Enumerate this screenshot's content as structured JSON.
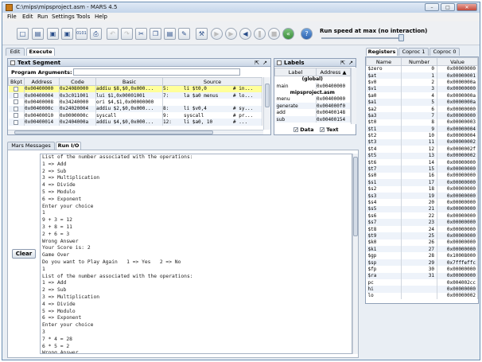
{
  "window": {
    "title": "C:\\mips\\mipsproject.asm  - MARS 4.5"
  },
  "menu": [
    "File",
    "Edit",
    "Run",
    "Settings",
    "Tools",
    "Help"
  ],
  "toolbar": {
    "speed_label": "Run speed at max (no interaction)"
  },
  "tabs": {
    "edit": "Edit",
    "execute": "Execute"
  },
  "text_segment": {
    "title": "Text Segment",
    "program_arguments": "Program Arguments:",
    "columns": [
      "Bkpt",
      "Address",
      "Code",
      "Basic",
      "Source"
    ],
    "rows": [
      {
        "address": "0x00400000",
        "code": "0x24080000",
        "basic": "addiu $8,$0,0x000...",
        "line": "5:",
        "source": "li $t0,0",
        "comment": "# in..."
      },
      {
        "address": "0x00400004",
        "code": "0x3c011001",
        "basic": "lui $1,0x00001001",
        "line": "7:",
        "source": "la $a0 menus",
        "comment": "# lo..."
      },
      {
        "address": "0x00400008",
        "code": "0x34240000",
        "basic": "ori $4,$1,0x00000000",
        "line": "",
        "source": "",
        "comment": ""
      },
      {
        "address": "0x0040000c",
        "code": "0x24020004",
        "basic": "addiu $2,$0,0x000...",
        "line": "8:",
        "source": "li $v0,4",
        "comment": "# sy..."
      },
      {
        "address": "0x00400010",
        "code": "0x0000000c",
        "basic": "syscall",
        "line": "9:",
        "source": "syscall",
        "comment": "# pr..."
      },
      {
        "address": "0x00400014",
        "code": "0x2404000a",
        "basic": "addiu $4,$0,0x000...",
        "line": "12:",
        "source": "li $a0, 10",
        "comment": "# ..."
      }
    ]
  },
  "labels": {
    "title": "Labels",
    "columns": [
      "Label",
      "Address ▲"
    ],
    "groups": [
      {
        "name": "(global)",
        "items": [
          {
            "label": "main",
            "address": "0x00400000"
          }
        ]
      },
      {
        "name": "mipsproject.asm",
        "items": [
          {
            "label": "menu",
            "address": "0x00400000"
          },
          {
            "label": "generate",
            "address": "0x004000f0"
          },
          {
            "label": "add",
            "address": "0x00400148"
          },
          {
            "label": "sub",
            "address": "0x00400154"
          }
        ]
      }
    ],
    "data_check": "Data",
    "text_check": "Text"
  },
  "bottom_tabs": {
    "messages": "Mars Messages",
    "run_io": "Run I/O"
  },
  "clear_button": "Clear",
  "console_lines": [
    "List of the number associated with the operations:",
    "1 => Add",
    "2 => Sub",
    "3 => Multiplication",
    "4 => Divide",
    "5 => Modulo",
    "6 => Exponent",
    "Enter your choice",
    "1",
    "9 + 3 = 12",
    "3 + 8 = 11",
    "2 + 6 = 3",
    "Wrong Answer",
    "Your Score is: 2",
    "Game Over",
    "Do you want to Play Again   1 => Yes   2 => No",
    "1",
    "List of the number associated with the operations:",
    "1 => Add",
    "2 => Sub",
    "3 => Multiplication",
    "4 => Divide",
    "5 => Modulo",
    "6 => Exponent",
    "Enter your choice",
    "3",
    "7 * 4 = 28",
    "6 * 5 = 2",
    "Wrong Answer"
  ],
  "register_tabs": [
    "Registers",
    "Coproc 1",
    "Coproc 0"
  ],
  "register_columns": [
    "Name",
    "Number",
    "Value"
  ],
  "registers": [
    {
      "name": "$zero",
      "number": "0",
      "value": "0x00000000"
    },
    {
      "name": "$at",
      "number": "1",
      "value": "0x00000001"
    },
    {
      "name": "$v0",
      "number": "2",
      "value": "0x0000000a"
    },
    {
      "name": "$v1",
      "number": "3",
      "value": "0x00000000"
    },
    {
      "name": "$a0",
      "number": "4",
      "value": "0x0000000a"
    },
    {
      "name": "$a1",
      "number": "5",
      "value": "0x0000000a"
    },
    {
      "name": "$a2",
      "number": "6",
      "value": "0x00000000"
    },
    {
      "name": "$a3",
      "number": "7",
      "value": "0x00000000"
    },
    {
      "name": "$t0",
      "number": "8",
      "value": "0x00000003"
    },
    {
      "name": "$t1",
      "number": "9",
      "value": "0x00000004"
    },
    {
      "name": "$t2",
      "number": "10",
      "value": "0x00000004"
    },
    {
      "name": "$t3",
      "number": "11",
      "value": "0x00000002"
    },
    {
      "name": "$t4",
      "number": "12",
      "value": "0x0000002f"
    },
    {
      "name": "$t5",
      "number": "13",
      "value": "0x00000002"
    },
    {
      "name": "$t6",
      "number": "14",
      "value": "0x00000000"
    },
    {
      "name": "$t7",
      "number": "15",
      "value": "0x00000000"
    },
    {
      "name": "$s0",
      "number": "16",
      "value": "0x00000000"
    },
    {
      "name": "$s1",
      "number": "17",
      "value": "0x00000000"
    },
    {
      "name": "$s2",
      "number": "18",
      "value": "0x00000000"
    },
    {
      "name": "$s3",
      "number": "19",
      "value": "0x00000000"
    },
    {
      "name": "$s4",
      "number": "20",
      "value": "0x00000000"
    },
    {
      "name": "$s5",
      "number": "21",
      "value": "0x00000000"
    },
    {
      "name": "$s6",
      "number": "22",
      "value": "0x00000000"
    },
    {
      "name": "$s7",
      "number": "23",
      "value": "0x00000000"
    },
    {
      "name": "$t8",
      "number": "24",
      "value": "0x00000000"
    },
    {
      "name": "$t9",
      "number": "25",
      "value": "0x00000000"
    },
    {
      "name": "$k0",
      "number": "26",
      "value": "0x00000000"
    },
    {
      "name": "$k1",
      "number": "27",
      "value": "0x00000000"
    },
    {
      "name": "$gp",
      "number": "28",
      "value": "0x10008000"
    },
    {
      "name": "$sp",
      "number": "29",
      "value": "0x7fffeffc"
    },
    {
      "name": "$fp",
      "number": "30",
      "value": "0x00000000"
    },
    {
      "name": "$ra",
      "number": "31",
      "value": "0x00000000"
    },
    {
      "name": "pc",
      "number": "",
      "value": "0x004002cc"
    },
    {
      "name": "hi",
      "number": "",
      "value": "0x00000000"
    },
    {
      "name": "lo",
      "number": "",
      "value": "0x00000002"
    }
  ]
}
